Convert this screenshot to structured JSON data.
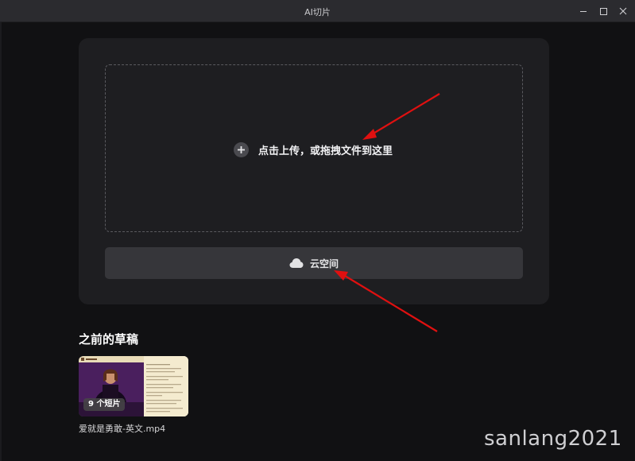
{
  "window": {
    "title": "AI切片"
  },
  "upload": {
    "drop_text": "点击上传，或拖拽文件到这里",
    "cloud_label": "云空间"
  },
  "drafts": {
    "heading": "之前的草稿",
    "items": [
      {
        "clip_count": "9 个短片",
        "name": "爱就是勇敢-英文.mp4"
      }
    ]
  },
  "watermark": "sanlang2021",
  "icons": {
    "upload": "plus-circle-icon",
    "cloud": "cloud-icon",
    "minimize": "minimize-icon",
    "maximize": "maximize-icon",
    "close": "close-icon"
  },
  "colors": {
    "background": "#111113",
    "panel": "#1e1e21",
    "cloud_button": "#36363a",
    "annotation_arrow": "#e01010"
  }
}
